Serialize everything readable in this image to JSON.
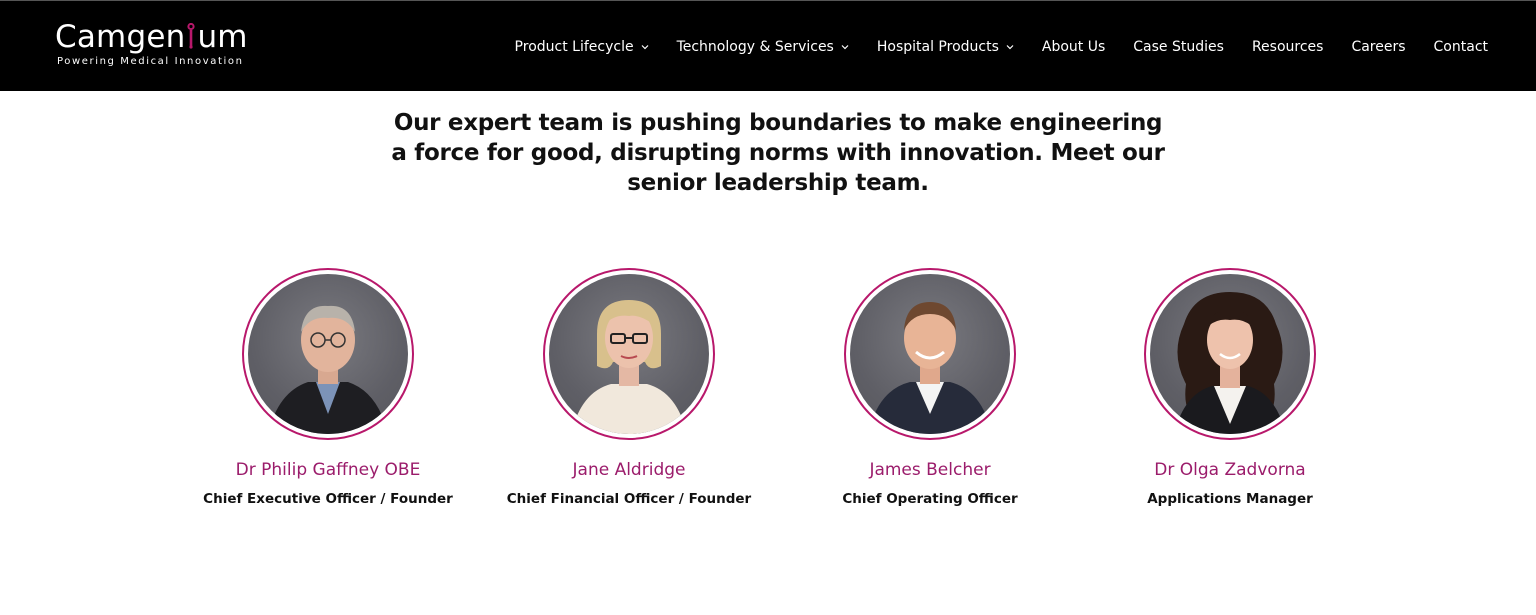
{
  "brand": {
    "name_part1": "Camgen",
    "name_part2": "um",
    "tagline": "Powering Medical Innovation",
    "accent_color": "#b8186b"
  },
  "nav": {
    "items": [
      {
        "label": "Product Lifecycle",
        "has_dropdown": true
      },
      {
        "label": "Technology & Services",
        "has_dropdown": true
      },
      {
        "label": "Hospital Products",
        "has_dropdown": true
      },
      {
        "label": "About Us",
        "has_dropdown": false
      },
      {
        "label": "Case Studies",
        "has_dropdown": false
      },
      {
        "label": "Resources",
        "has_dropdown": false
      },
      {
        "label": "Careers",
        "has_dropdown": false
      },
      {
        "label": "Contact",
        "has_dropdown": false
      }
    ]
  },
  "intro": {
    "line1": "Our expert team is pushing boundaries to make engineering",
    "line2": "a force for good, disrupting norms with innovation. Meet our",
    "line3": "senior leadership team."
  },
  "team": [
    {
      "name": "Dr Philip Gaffney OBE",
      "role": "Chief Executive Officer / Founder"
    },
    {
      "name": "Jane Aldridge",
      "role": "Chief Financial Officer / Founder"
    },
    {
      "name": "James Belcher",
      "role": "Chief Operating Officer"
    },
    {
      "name": "Dr Olga Zadvorna",
      "role": "Applications Manager"
    }
  ],
  "colors": {
    "header_bg": "#000000",
    "name_color": "#9b1c6b",
    "ring_color": "#b8186b"
  }
}
